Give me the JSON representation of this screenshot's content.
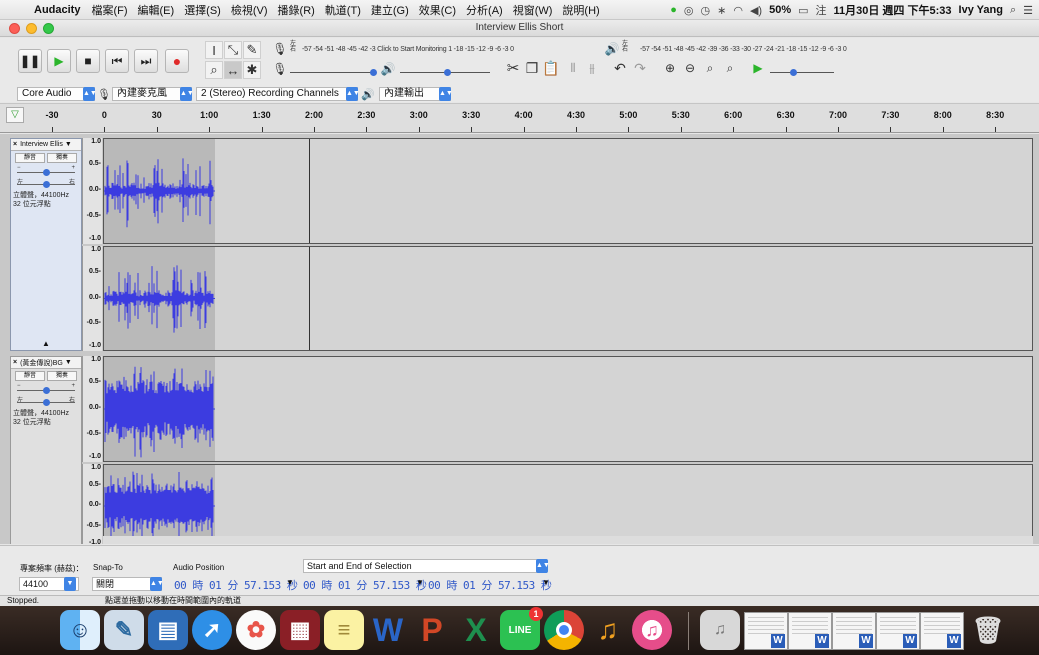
{
  "menubar": {
    "app_name": "Audacity",
    "menus": [
      "檔案(F)",
      "編輯(E)",
      "選擇(S)",
      "檢視(V)",
      "播錄(R)",
      "軌道(T)",
      "建立(G)",
      "效果(C)",
      "分析(A)",
      "視窗(W)",
      "說明(H)"
    ],
    "battery": "50%",
    "datetime": "11月30日 週四 下午5:33",
    "user": "Ivy Yang"
  },
  "window": {
    "title": "Interview Ellis Short"
  },
  "toolbar": {
    "meter_record_label": "-57 -54 -51 -48 -45 -42 -3 Click to Start Monitoring 1 -18 -15 -12 -9 -6 -3 0",
    "meter_play_label": "-57 -54 -51 -48 -45 -42 -39 -36 -33 -30 -27 -24 -21 -18 -15 -12 -9 -6 -3 0",
    "meter_left": "左",
    "meter_right": "右"
  },
  "device": {
    "host": "Core Audio",
    "input": "內建麥克風",
    "channels": "2 (Stereo) Recording Channels",
    "output": "內建輸出"
  },
  "ruler": {
    "labels": [
      "-30",
      "0",
      "30",
      "1:00",
      "1:30",
      "2:00",
      "2:30",
      "3:00",
      "3:30",
      "4:00",
      "4:30",
      "5:00",
      "5:30",
      "6:00",
      "6:30",
      "7:00",
      "7:30",
      "8:00",
      "8:30"
    ]
  },
  "tracks": [
    {
      "name": "Interview Ellis",
      "mute": "靜音",
      "solo": "獨奏",
      "info_line1": "立體聲，44100Hz",
      "info_line2": "32 位元浮點",
      "scale": [
        "1.0",
        "0.5-",
        "0.0-",
        "-0.5-",
        "-1.0"
      ]
    },
    {
      "name": "(黃金傳說)BG",
      "mute": "靜音",
      "solo": "獨奏",
      "info_line1": "立體聲，44100Hz",
      "info_line2": "32 位元浮點",
      "scale": [
        "1.0",
        "0.5-",
        "0.0-",
        "-0.5-",
        "-1.0"
      ]
    }
  ],
  "selection": {
    "rate_label": "專案頻率 (赫茲)：",
    "rate_value": "44100",
    "snap_label": "Snap-To",
    "snap_value": "關閉",
    "audio_pos_label": "Audio Position",
    "sel_mode": "Start and End of Selection",
    "audio_pos": "00 時 01 分 57.153 秒",
    "sel_start": "00 時 01 分 57.153 秒",
    "sel_end": "00 時 01 分 57.153 秒"
  },
  "status": {
    "state": "Stopped.",
    "hint": "點選並拖動以移動在時間範圍內的軌道"
  },
  "colors": {
    "waveform": "#3c3ce0",
    "accent": "#3f84e5"
  },
  "dock": {
    "apps": [
      "finder-icon",
      "preview-icon",
      "keynote-icon",
      "safari-icon",
      "photos-icon",
      "photo-booth-icon",
      "notes-icon",
      "word-icon",
      "powerpoint-icon",
      "excel-icon",
      "line-icon",
      "chrome-icon",
      "audacity-icon",
      "itunes-icon"
    ],
    "line_badge": "1"
  }
}
